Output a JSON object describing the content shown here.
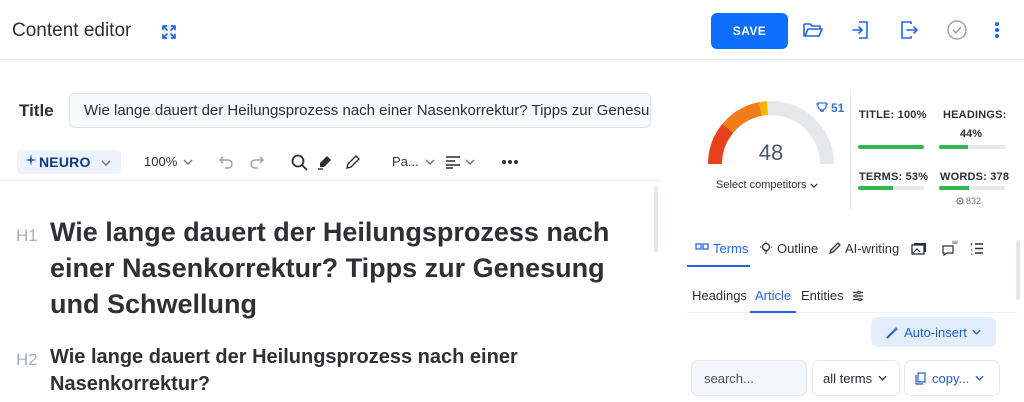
{
  "header": {
    "title": "Content editor",
    "save_label": "SAVE",
    "accent_color": "#0d6efd"
  },
  "icons": [
    "expand-icon",
    "folder-open-icon",
    "import-icon",
    "export-icon",
    "check-circle-icon",
    "kebab-menu-icon"
  ],
  "title_field": {
    "label": "Title",
    "value": "Wie lange dauert der Heilungsprozess nach einer Nasenkorrektur? Tipps zur Genesung"
  },
  "toolbar": {
    "brand": "NEURO",
    "zoom": "100%",
    "paragraph": "Pa..."
  },
  "editor": {
    "h1_tag": "H1",
    "h1_text": "Wie lange dauert der Heilungsprozess nach einer Nasenkorrektur? Tipps zur Genesung und Schwellung",
    "h2_tag": "H2",
    "h2_text": "Wie lange dauert der Heilungsprozess nach einer Nasenkorrektur?"
  },
  "score_panel": {
    "score": "48",
    "target": "51",
    "score_fraction": 0.48,
    "competitors_label": "Select competitors",
    "stats": {
      "title": {
        "label": "TITLE: 100%",
        "fill": 1.0
      },
      "headings": {
        "label": "HEADINGS:",
        "value": "44%",
        "fill": 0.44
      },
      "terms": {
        "label": "TERMS: 53%",
        "fill": 0.53
      },
      "words": {
        "label": "WORDS: 378",
        "fill": 0.45,
        "note": "832"
      }
    }
  },
  "tabs": {
    "main": [
      "Terms",
      "Outline",
      "AI-writing"
    ],
    "sub": [
      "Headings",
      "Article",
      "Entities"
    ]
  },
  "actions": {
    "auto_insert": "Auto-insert",
    "search_placeholder": "search...",
    "filter": "all terms",
    "copy": "copy..."
  }
}
